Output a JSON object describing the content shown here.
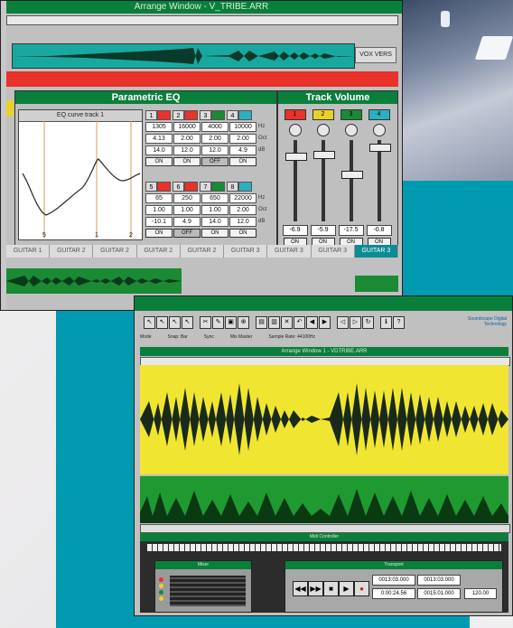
{
  "arrange_window": {
    "title": "Arrange Window - V_TRIBE.ARR",
    "track_label": "VOX VERS",
    "guitar_tracks": [
      "GUITAR 1",
      "GUITAR 2",
      "GUITAR 2",
      "GUITAR 2",
      "GUITAR 2",
      "GUITAR 3",
      "GUITAR 3",
      "GUITAR 3",
      "GUITAR 3"
    ],
    "selected_guitar_index": 8
  },
  "eq": {
    "title": "Parametric EQ",
    "curve_label": "EQ curve track 1",
    "curve_markers": [
      "5",
      "1",
      "2"
    ],
    "units": {
      "freq": "Hz",
      "bw": "Oct",
      "gain": "dB"
    },
    "top_bands": [
      {
        "num": "1",
        "color": "#e8322a",
        "freq": "1305",
        "bw": "4.13",
        "gain": "14.0",
        "state": "ON"
      },
      {
        "num": "2",
        "color": "#e8322a",
        "freq": "16000",
        "bw": "2.00",
        "gain": "12.0",
        "state": "ON"
      },
      {
        "num": "3",
        "color": "#1a8a35",
        "freq": "4000",
        "bw": "2.00",
        "gain": "12.0",
        "state": "OFF"
      },
      {
        "num": "4",
        "color": "#2ab0c0",
        "freq": "10000",
        "bw": "2.00",
        "gain": "4.9",
        "state": "ON"
      }
    ],
    "bottom_bands": [
      {
        "num": "5",
        "color": "#e8322a",
        "freq": "65",
        "bw": "1.00",
        "gain": "-10.1",
        "state": "ON"
      },
      {
        "num": "6",
        "color": "#e8322a",
        "freq": "250",
        "bw": "1.00",
        "gain": "4.9",
        "state": "OFF"
      },
      {
        "num": "7",
        "color": "#1a8a35",
        "freq": "650",
        "bw": "1.00",
        "gain": "14.0",
        "state": "ON"
      },
      {
        "num": "8",
        "color": "#2ab0c0",
        "freq": "22000",
        "bw": "2.00",
        "gain": "12.0",
        "state": "ON"
      }
    ]
  },
  "track_volume": {
    "title": "Track Volume",
    "channels": [
      {
        "num": "1",
        "color": "#e8322a",
        "value": "-6.9",
        "state": "ON"
      },
      {
        "num": "2",
        "color": "#e8d22a",
        "value": "-5.9",
        "state": "ON"
      },
      {
        "num": "3",
        "color": "#1a8a35",
        "value": "-17.5",
        "state": "ON"
      },
      {
        "num": "4",
        "color": "#2ab0c0",
        "value": "-0.8",
        "state": "ON"
      }
    ]
  },
  "second_window": {
    "title": "Arrange Window 1 - VDTRIBE.ARR",
    "status": [
      "Mode",
      "Snap: Bar",
      "Sync",
      "Mix Master",
      "Sample Rate: 44100Hz"
    ],
    "brand": "Soundscape Digital Technology",
    "midi_title": "Midi Controller",
    "mixer_title": "Mixer",
    "transport_title": "Transport",
    "transport_buttons": [
      "◀◀",
      "▶▶",
      "■",
      "▶",
      "●"
    ],
    "counters": [
      "0013:03.000",
      "0013:03.000",
      "0:00:24.56",
      "0015:01.000"
    ],
    "tempo": "120.00"
  },
  "colors": {
    "teal": "#009ab0",
    "green": "#0a7f3c",
    "yellow": "#f0e632",
    "red": "#e8322a"
  }
}
